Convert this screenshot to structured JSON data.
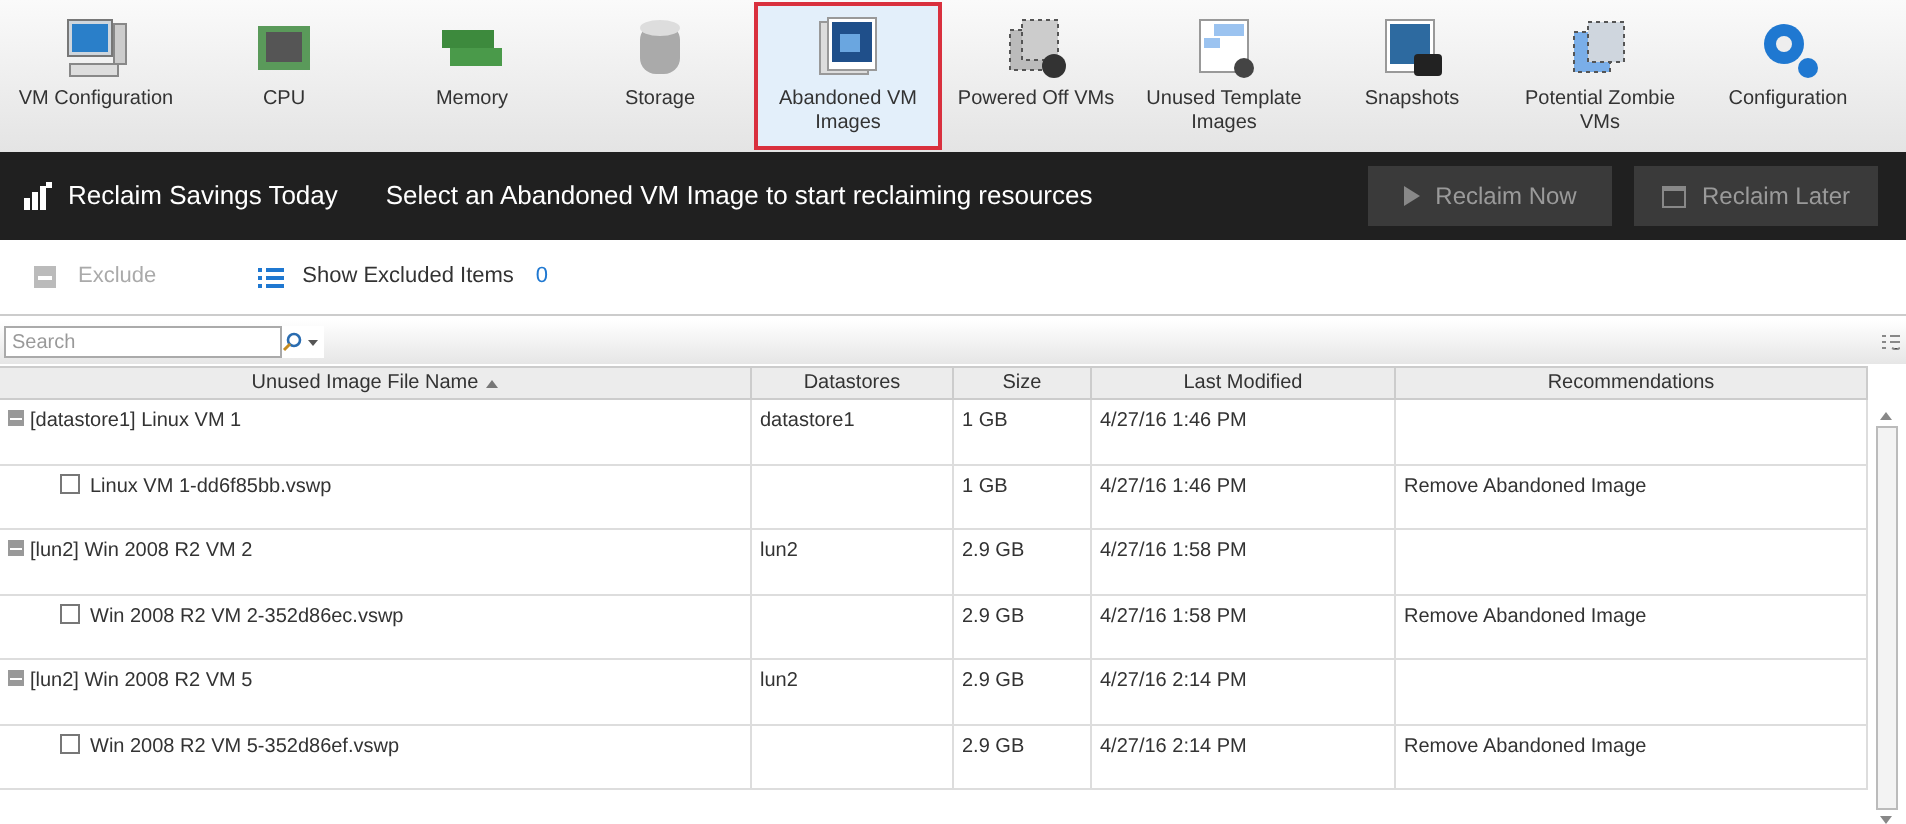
{
  "toolbar": [
    {
      "label": "VM Configuration",
      "selected": false
    },
    {
      "label": "CPU",
      "selected": false
    },
    {
      "label": "Memory",
      "selected": false
    },
    {
      "label": "Storage",
      "selected": false
    },
    {
      "label": "Abandoned VM Images",
      "selected": true
    },
    {
      "label": "Powered Off VMs",
      "selected": false
    },
    {
      "label": "Unused Template Images",
      "selected": false
    },
    {
      "label": "Snapshots",
      "selected": false
    },
    {
      "label": "Potential Zombie VMs",
      "selected": false
    },
    {
      "label": "Configuration",
      "selected": false
    }
  ],
  "banner": {
    "title": "Reclaim Savings Today",
    "message": "Select an Abandoned VM Image to start reclaiming resources",
    "buttons": [
      {
        "label": "Reclaim Now",
        "disabled": true
      },
      {
        "label": "Reclaim Later",
        "disabled": true
      }
    ]
  },
  "actions": {
    "exclude": {
      "label": "Exclude",
      "disabled": true
    },
    "show_excluded": {
      "label": "Show Excluded Items",
      "count": "0"
    }
  },
  "search": {
    "placeholder": "Search"
  },
  "table": {
    "columns": [
      "Unused Image File Name",
      "Datastores",
      "Size",
      "Last Modified",
      "Recommendations"
    ],
    "rows": [
      {
        "kind": "group",
        "expanded": true,
        "cells": [
          "[datastore1] Linux VM 1",
          "datastore1",
          "1 GB",
          "4/27/16 1:46 PM",
          ""
        ]
      },
      {
        "kind": "file",
        "checked": false,
        "cells": [
          "Linux VM 1-dd6f85bb.vswp",
          "",
          "1 GB",
          "4/27/16 1:46 PM",
          "Remove Abandoned Image"
        ]
      },
      {
        "kind": "group",
        "expanded": true,
        "cells": [
          "[lun2] Win 2008 R2 VM 2",
          "lun2",
          "2.9 GB",
          "4/27/16 1:58 PM",
          ""
        ]
      },
      {
        "kind": "file",
        "checked": false,
        "cells": [
          "Win 2008 R2 VM 2-352d86ec.vswp",
          "",
          "2.9 GB",
          "4/27/16 1:58 PM",
          "Remove Abandoned Image"
        ]
      },
      {
        "kind": "group",
        "expanded": true,
        "cells": [
          "[lun2] Win 2008 R2 VM 5",
          "lun2",
          "2.9 GB",
          "4/27/16 2:14 PM",
          ""
        ]
      },
      {
        "kind": "file",
        "checked": false,
        "cells": [
          "Win 2008 R2 VM 5-352d86ef.vswp",
          "",
          "2.9 GB",
          "4/27/16 2:14 PM",
          "Remove Abandoned Image"
        ]
      }
    ]
  }
}
